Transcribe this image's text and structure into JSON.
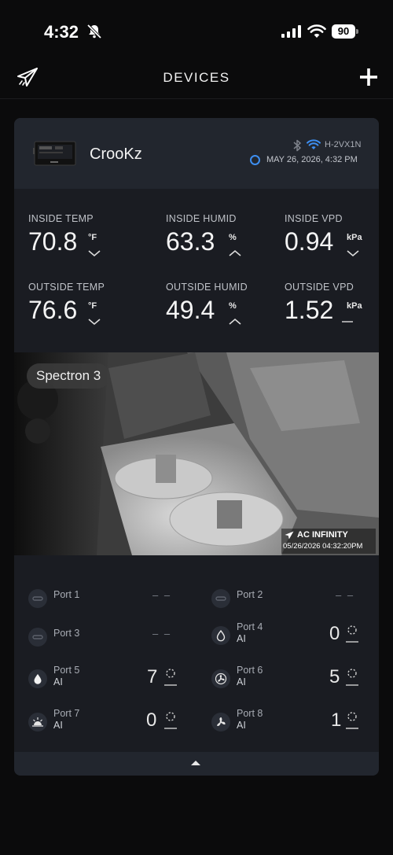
{
  "status_bar": {
    "time": "4:32",
    "battery": "90"
  },
  "nav": {
    "title": "DEVICES"
  },
  "device": {
    "name": "CrooKz",
    "id": "H-2VX1N",
    "timestamp": "MAY 26, 2026, 4:32 PM",
    "metrics": [
      {
        "label": "INSIDE TEMP",
        "value": "70.8",
        "unit": "°F",
        "trend": "down"
      },
      {
        "label": "INSIDE HUMID",
        "value": "63.3",
        "unit": "%",
        "trend": "up"
      },
      {
        "label": "INSIDE VPD",
        "value": "0.94",
        "unit": "kPa",
        "trend": "down"
      },
      {
        "label": "OUTSIDE TEMP",
        "value": "76.6",
        "unit": "°F",
        "trend": "down"
      },
      {
        "label": "OUTSIDE HUMID",
        "value": "49.4",
        "unit": "%",
        "trend": "up"
      },
      {
        "label": "OUTSIDE VPD",
        "value": "1.52",
        "unit": "kPa",
        "trend": "flat"
      }
    ],
    "camera": {
      "label": "Spectron 3",
      "watermark_brand": "AC INFINITY",
      "watermark_time": "05/26/2026  04:32:20PM"
    },
    "ports": [
      {
        "name": "Port 1",
        "mode": "",
        "value": "– –",
        "icon": "plug-icon"
      },
      {
        "name": "Port 2",
        "mode": "",
        "value": "– –",
        "icon": "plug-icon"
      },
      {
        "name": "Port 3",
        "mode": "",
        "value": "– –",
        "icon": "plug-icon"
      },
      {
        "name": "Port 4",
        "mode": "AI",
        "value": "0",
        "icon": "humidifier-drop-icon"
      },
      {
        "name": "Port 5",
        "mode": "AI",
        "value": "7",
        "icon": "water-drop-icon"
      },
      {
        "name": "Port 6",
        "mode": "AI",
        "value": "5",
        "icon": "fan-icon"
      },
      {
        "name": "Port 7",
        "mode": "AI",
        "value": "0",
        "icon": "grow-light-icon"
      },
      {
        "name": "Port 8",
        "mode": "AI",
        "value": "1",
        "icon": "fan-icon"
      }
    ]
  },
  "colors": {
    "background": "#0b0b0c",
    "card": "#1a1c22",
    "card_header": "#22262e",
    "accent_blue": "#3d8ef0"
  }
}
